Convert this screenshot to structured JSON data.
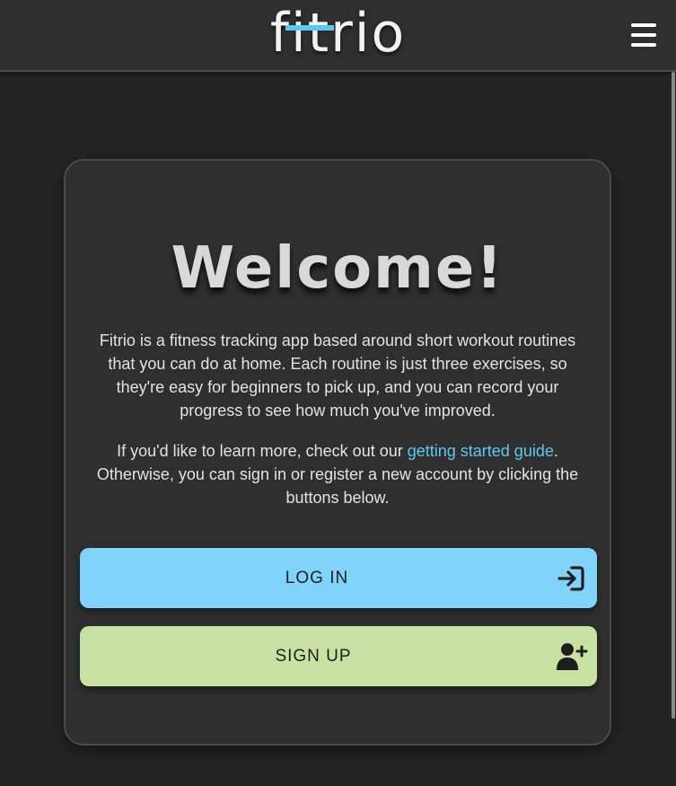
{
  "navbar": {
    "logo_prefix": "f",
    "logo_i": "i",
    "logo_t": "t",
    "logo_suffix": "rio",
    "menu_icon": "hamburger-menu-icon"
  },
  "welcome": {
    "title": "Welcome!",
    "intro": "Fitrio is a fitness tracking app based around short workout routines that you can do at home. Each routine is just three exercises, so they're easy for beginners to pick up, and you can record your progress to see how much you've improved.",
    "guide_prefix": "If you'd like to learn more, check out our ",
    "guide_link": "getting started guide",
    "guide_suffix": ". Otherwise, you can sign in or register a new account by clicking the buttons below."
  },
  "buttons": {
    "login_label": "LOG IN",
    "login_icon": "login-arrow-icon",
    "signup_label": "SIGN UP",
    "signup_icon": "add-user-icon"
  },
  "colors": {
    "accent": "#5cc8f2",
    "login_button": "#80d4fb",
    "signup_button": "#c7e1a3",
    "background": "#242424",
    "card": "#2f2f2f"
  }
}
